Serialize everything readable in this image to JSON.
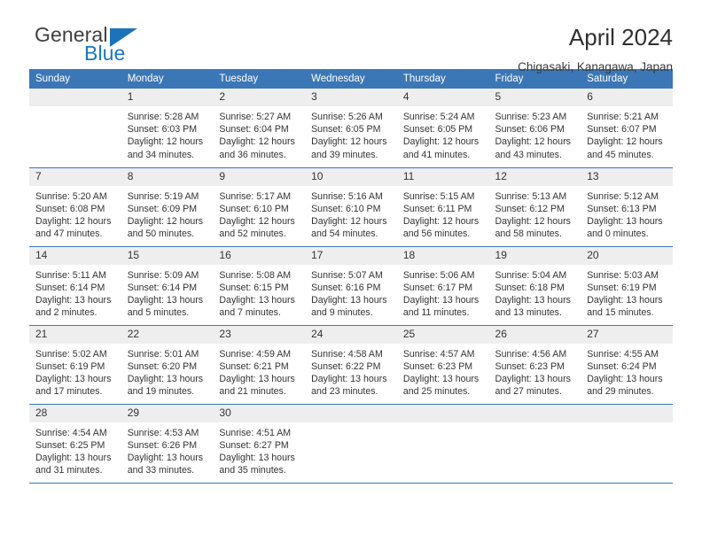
{
  "brand": {
    "name_top": "General",
    "name_bottom": "Blue",
    "triangle_color": "#1b74ba",
    "blue_color": "#1878be"
  },
  "header": {
    "title": "April 2024",
    "subtitle": "Chigasaki, Kanagawa, Japan"
  },
  "theme": {
    "header_bg": "#3b77b6",
    "header_text": "#ffffff",
    "daynum_bg": "#eeeeee",
    "grid_line": "#3b77b6"
  },
  "weekday_headers": [
    "Sunday",
    "Monday",
    "Tuesday",
    "Wednesday",
    "Thursday",
    "Friday",
    "Saturday"
  ],
  "weeks": [
    [
      {
        "day": "",
        "l1": "",
        "l2": "",
        "l3": "",
        "l4": ""
      },
      {
        "day": "1",
        "l1": "Sunrise: 5:28 AM",
        "l2": "Sunset: 6:03 PM",
        "l3": "Daylight: 12 hours",
        "l4": "and 34 minutes."
      },
      {
        "day": "2",
        "l1": "Sunrise: 5:27 AM",
        "l2": "Sunset: 6:04 PM",
        "l3": "Daylight: 12 hours",
        "l4": "and 36 minutes."
      },
      {
        "day": "3",
        "l1": "Sunrise: 5:26 AM",
        "l2": "Sunset: 6:05 PM",
        "l3": "Daylight: 12 hours",
        "l4": "and 39 minutes."
      },
      {
        "day": "4",
        "l1": "Sunrise: 5:24 AM",
        "l2": "Sunset: 6:05 PM",
        "l3": "Daylight: 12 hours",
        "l4": "and 41 minutes."
      },
      {
        "day": "5",
        "l1": "Sunrise: 5:23 AM",
        "l2": "Sunset: 6:06 PM",
        "l3": "Daylight: 12 hours",
        "l4": "and 43 minutes."
      },
      {
        "day": "6",
        "l1": "Sunrise: 5:21 AM",
        "l2": "Sunset: 6:07 PM",
        "l3": "Daylight: 12 hours",
        "l4": "and 45 minutes."
      }
    ],
    [
      {
        "day": "7",
        "l1": "Sunrise: 5:20 AM",
        "l2": "Sunset: 6:08 PM",
        "l3": "Daylight: 12 hours",
        "l4": "and 47 minutes."
      },
      {
        "day": "8",
        "l1": "Sunrise: 5:19 AM",
        "l2": "Sunset: 6:09 PM",
        "l3": "Daylight: 12 hours",
        "l4": "and 50 minutes."
      },
      {
        "day": "9",
        "l1": "Sunrise: 5:17 AM",
        "l2": "Sunset: 6:10 PM",
        "l3": "Daylight: 12 hours",
        "l4": "and 52 minutes."
      },
      {
        "day": "10",
        "l1": "Sunrise: 5:16 AM",
        "l2": "Sunset: 6:10 PM",
        "l3": "Daylight: 12 hours",
        "l4": "and 54 minutes."
      },
      {
        "day": "11",
        "l1": "Sunrise: 5:15 AM",
        "l2": "Sunset: 6:11 PM",
        "l3": "Daylight: 12 hours",
        "l4": "and 56 minutes."
      },
      {
        "day": "12",
        "l1": "Sunrise: 5:13 AM",
        "l2": "Sunset: 6:12 PM",
        "l3": "Daylight: 12 hours",
        "l4": "and 58 minutes."
      },
      {
        "day": "13",
        "l1": "Sunrise: 5:12 AM",
        "l2": "Sunset: 6:13 PM",
        "l3": "Daylight: 13 hours",
        "l4": "and 0 minutes."
      }
    ],
    [
      {
        "day": "14",
        "l1": "Sunrise: 5:11 AM",
        "l2": "Sunset: 6:14 PM",
        "l3": "Daylight: 13 hours",
        "l4": "and 2 minutes."
      },
      {
        "day": "15",
        "l1": "Sunrise: 5:09 AM",
        "l2": "Sunset: 6:14 PM",
        "l3": "Daylight: 13 hours",
        "l4": "and 5 minutes."
      },
      {
        "day": "16",
        "l1": "Sunrise: 5:08 AM",
        "l2": "Sunset: 6:15 PM",
        "l3": "Daylight: 13 hours",
        "l4": "and 7 minutes."
      },
      {
        "day": "17",
        "l1": "Sunrise: 5:07 AM",
        "l2": "Sunset: 6:16 PM",
        "l3": "Daylight: 13 hours",
        "l4": "and 9 minutes."
      },
      {
        "day": "18",
        "l1": "Sunrise: 5:06 AM",
        "l2": "Sunset: 6:17 PM",
        "l3": "Daylight: 13 hours",
        "l4": "and 11 minutes."
      },
      {
        "day": "19",
        "l1": "Sunrise: 5:04 AM",
        "l2": "Sunset: 6:18 PM",
        "l3": "Daylight: 13 hours",
        "l4": "and 13 minutes."
      },
      {
        "day": "20",
        "l1": "Sunrise: 5:03 AM",
        "l2": "Sunset: 6:19 PM",
        "l3": "Daylight: 13 hours",
        "l4": "and 15 minutes."
      }
    ],
    [
      {
        "day": "21",
        "l1": "Sunrise: 5:02 AM",
        "l2": "Sunset: 6:19 PM",
        "l3": "Daylight: 13 hours",
        "l4": "and 17 minutes."
      },
      {
        "day": "22",
        "l1": "Sunrise: 5:01 AM",
        "l2": "Sunset: 6:20 PM",
        "l3": "Daylight: 13 hours",
        "l4": "and 19 minutes."
      },
      {
        "day": "23",
        "l1": "Sunrise: 4:59 AM",
        "l2": "Sunset: 6:21 PM",
        "l3": "Daylight: 13 hours",
        "l4": "and 21 minutes."
      },
      {
        "day": "24",
        "l1": "Sunrise: 4:58 AM",
        "l2": "Sunset: 6:22 PM",
        "l3": "Daylight: 13 hours",
        "l4": "and 23 minutes."
      },
      {
        "day": "25",
        "l1": "Sunrise: 4:57 AM",
        "l2": "Sunset: 6:23 PM",
        "l3": "Daylight: 13 hours",
        "l4": "and 25 minutes."
      },
      {
        "day": "26",
        "l1": "Sunrise: 4:56 AM",
        "l2": "Sunset: 6:23 PM",
        "l3": "Daylight: 13 hours",
        "l4": "and 27 minutes."
      },
      {
        "day": "27",
        "l1": "Sunrise: 4:55 AM",
        "l2": "Sunset: 6:24 PM",
        "l3": "Daylight: 13 hours",
        "l4": "and 29 minutes."
      }
    ],
    [
      {
        "day": "28",
        "l1": "Sunrise: 4:54 AM",
        "l2": "Sunset: 6:25 PM",
        "l3": "Daylight: 13 hours",
        "l4": "and 31 minutes."
      },
      {
        "day": "29",
        "l1": "Sunrise: 4:53 AM",
        "l2": "Sunset: 6:26 PM",
        "l3": "Daylight: 13 hours",
        "l4": "and 33 minutes."
      },
      {
        "day": "30",
        "l1": "Sunrise: 4:51 AM",
        "l2": "Sunset: 6:27 PM",
        "l3": "Daylight: 13 hours",
        "l4": "and 35 minutes."
      },
      {
        "day": "",
        "l1": "",
        "l2": "",
        "l3": "",
        "l4": ""
      },
      {
        "day": "",
        "l1": "",
        "l2": "",
        "l3": "",
        "l4": ""
      },
      {
        "day": "",
        "l1": "",
        "l2": "",
        "l3": "",
        "l4": ""
      },
      {
        "day": "",
        "l1": "",
        "l2": "",
        "l3": "",
        "l4": ""
      }
    ]
  ]
}
